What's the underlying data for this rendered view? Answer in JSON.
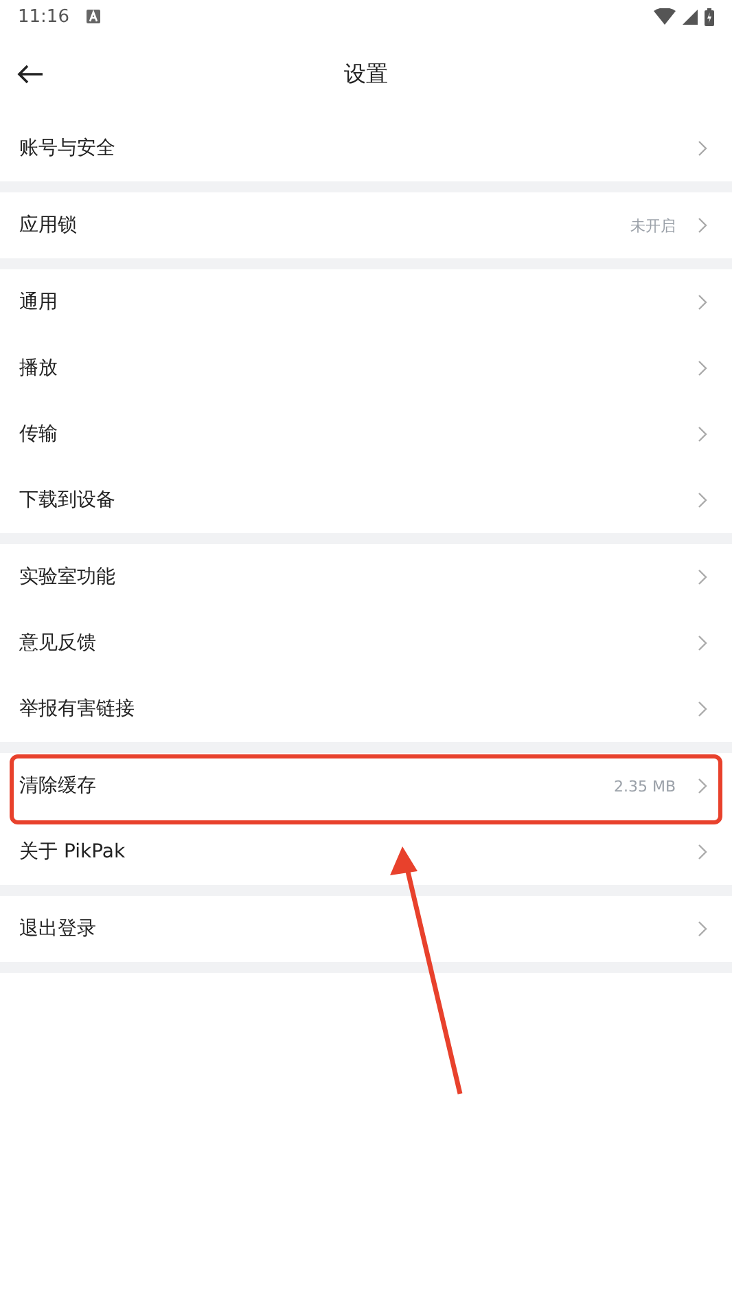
{
  "status_bar": {
    "time": "11:16"
  },
  "header": {
    "title": "设置"
  },
  "groups": [
    {
      "items": [
        {
          "label": "账号与安全",
          "highlighted": false
        }
      ]
    },
    {
      "items": [
        {
          "label": "应用锁",
          "value": "未开启",
          "highlighted": false
        }
      ]
    },
    {
      "items": [
        {
          "label": "通用",
          "highlighted": false
        },
        {
          "label": "播放",
          "highlighted": false
        },
        {
          "label": "传输",
          "highlighted": false
        },
        {
          "label": "下载到设备",
          "highlighted": false
        }
      ]
    },
    {
      "items": [
        {
          "label": "实验室功能",
          "highlighted": false
        },
        {
          "label": "意见反馈",
          "highlighted": false
        },
        {
          "label": "举报有害链接",
          "highlighted": false
        }
      ]
    },
    {
      "items": [
        {
          "label": "清除缓存",
          "value": "2.35 MB",
          "highlighted": true
        },
        {
          "label": "关于 PikPak",
          "highlighted": false
        }
      ]
    },
    {
      "items": [
        {
          "label": "退出登录",
          "highlighted": false
        }
      ]
    }
  ]
}
